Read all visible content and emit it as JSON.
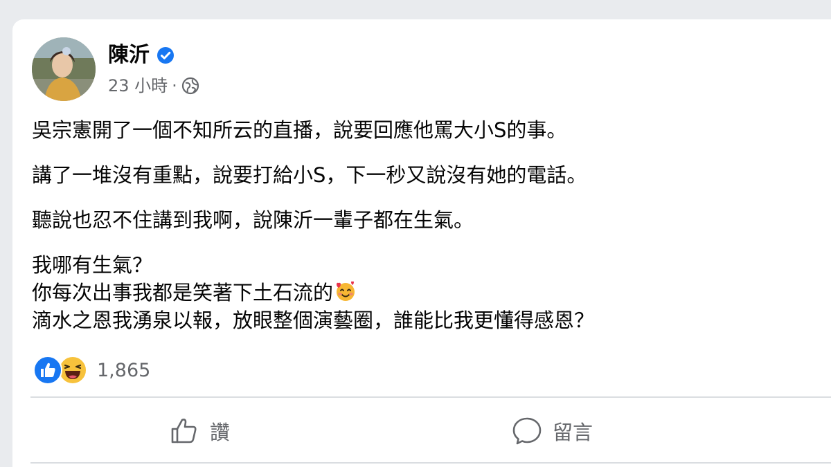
{
  "post": {
    "author": "陳沂",
    "time": "23 小時",
    "separator": "·",
    "paragraphs": [
      "吳宗憲開了一個不知所云的直播，說要回應他罵大小S的事。",
      "講了一堆沒有重點，說要打給小S，下一秒又說沒有她的電話。",
      "聽說也忍不住講到我啊，說陳沂一輩子都在生氣。"
    ],
    "closing_lines": [
      "我哪有生氣？",
      "你每次出事我都是笑著下土石流的",
      "滴水之恩我湧泉以報，放眼整個演藝圈，誰能比我更懂得感恩？"
    ],
    "reaction_count": "1,865",
    "reaction_icons": [
      "like-icon",
      "haha-icon"
    ]
  },
  "actions": {
    "like_label": "讚",
    "comment_label": "留言"
  },
  "colors": {
    "facebook_blue": "#1877f2",
    "text_primary": "#050505",
    "text_secondary": "#65676b",
    "page_background": "#e9ebee"
  }
}
